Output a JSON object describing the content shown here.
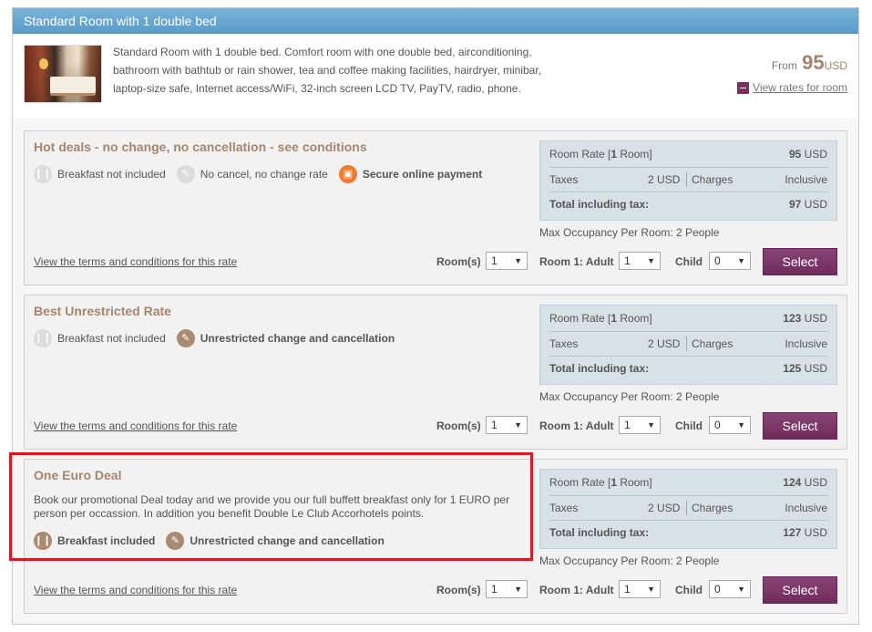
{
  "room": {
    "title": "Standard Room with 1 double bed",
    "description": "Standard Room with 1 double bed. Comfort room with one double bed, airconditioning, bathroom with bathtub or rain shower, tea and coffee making facilities, hairdryer, minibar, laptop-size safe, Internet access/WiFi, 32-inch screen LCD TV, PayTV, radio, phone.",
    "from_label": "From",
    "from_price": "95",
    "from_currency": "USD",
    "view_rates_label": "View rates for room"
  },
  "labels": {
    "room_rate": "Room Rate [",
    "room_rate_qty": "1",
    "room_rate_unit": " Room]",
    "taxes": "Taxes",
    "charges": "Charges",
    "total": "Total including tax:",
    "currency": "USD",
    "terms": "View the terms and conditions for this rate",
    "rooms": "Room(s)",
    "room1_adult": "Room 1: Adult",
    "child": "Child",
    "select": "Select"
  },
  "rates": [
    {
      "name": "Hot deals - no change, no cancellation - see conditions",
      "description": "",
      "features": [
        {
          "icon": "fork-knife-icon",
          "text": "Breakfast not included",
          "style": "off"
        },
        {
          "icon": "no-change-icon",
          "text": "No cancel, no change rate",
          "style": "off"
        },
        {
          "icon": "lock-icon",
          "text": "Secure online payment",
          "style": "orange"
        }
      ],
      "room_rate": "95",
      "taxes": "2",
      "charges": "Inclusive",
      "total": "97",
      "occupancy": "Max Occupancy Per Room: 2 People",
      "rooms_value": "1",
      "adult_value": "1",
      "child_value": "0"
    },
    {
      "name": "Best Unrestricted Rate",
      "description": "",
      "features": [
        {
          "icon": "fork-knife-icon",
          "text": "Breakfast not included",
          "style": "off"
        },
        {
          "icon": "change-cancel-icon",
          "text": "Unrestricted change and cancellation",
          "style": "brown"
        }
      ],
      "room_rate": "123",
      "taxes": "2",
      "charges": "Inclusive",
      "total": "125",
      "occupancy": "Max Occupancy Per Room: 2 People",
      "rooms_value": "1",
      "adult_value": "1",
      "child_value": "0"
    },
    {
      "name": "One Euro Deal",
      "description": "Book our promotional Deal today and we provide you our full buffett breakfast only for 1 EURO per person per occassion. In addition you benefit Double Le Club Accorhotels points.",
      "features": [
        {
          "icon": "fork-knife-icon",
          "text": "Breakfast included",
          "style": "brown"
        },
        {
          "icon": "change-cancel-icon",
          "text": "Unrestricted change and cancellation",
          "style": "brown"
        }
      ],
      "room_rate": "124",
      "taxes": "2",
      "charges": "Inclusive",
      "total": "127",
      "occupancy": "Max Occupancy Per Room: 2 People",
      "rooms_value": "1",
      "adult_value": "1",
      "child_value": "0"
    }
  ],
  "colors": {
    "header_blue": "#6aa6d1",
    "title_brown": "#a6866f",
    "select_purple": "#7a3569",
    "highlight_red": "#d41f1f",
    "secure_orange": "#f07b2a"
  }
}
